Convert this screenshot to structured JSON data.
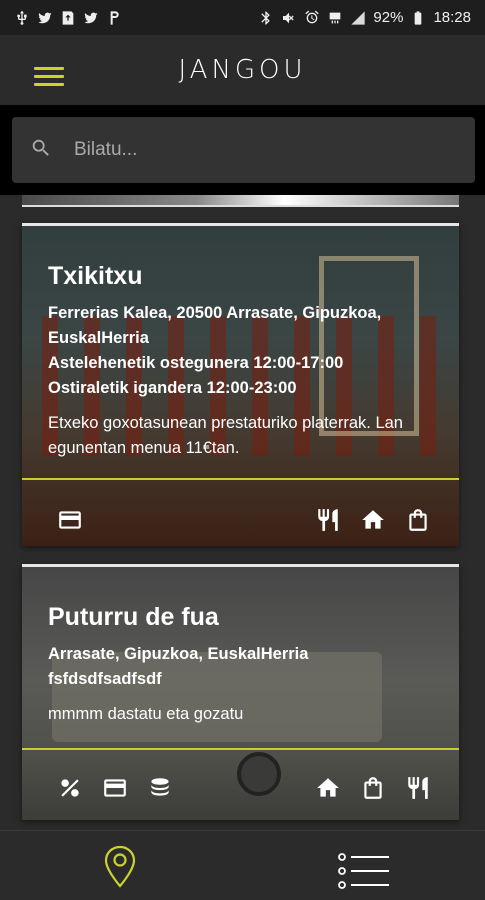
{
  "status_bar": {
    "battery": "92%",
    "time": "18:28"
  },
  "app": {
    "logo_text": "JANGOU",
    "accent_color": "#cbd32c"
  },
  "search": {
    "placeholder": "Bilatu..."
  },
  "cards": [
    {
      "title": "Txikitxu",
      "address": "Ferrerias Kalea, 20500 Arrasate, Gipuzkoa, EuskalHerria",
      "hours_1": "Astelehenetik ostegunera 12:00-17:00",
      "hours_2": "Ostiraletik igandera 12:00-23:00",
      "description": "Etxeko goxotasunean prestaturiko platerrak. Lan egunentan menua 11€tan.",
      "left_icons": [
        "credit-card-icon"
      ],
      "right_icons": [
        "utensils-icon",
        "home-icon",
        "shopping-bag-icon"
      ]
    },
    {
      "title": "Puturru de fua",
      "address": "Arrasate, Gipuzkoa, EuskalHerria",
      "hours_1": "fsfdsdfsadfsdf",
      "description": "mmmm dastatu eta gozatu",
      "left_icons": [
        "percent-icon",
        "credit-card-icon",
        "coins-icon"
      ],
      "right_icons": [
        "home-icon",
        "shopping-bag-icon",
        "utensils-icon"
      ]
    }
  ],
  "bottom_nav": {
    "items": [
      "map-pin-icon",
      "list-icon"
    ]
  }
}
